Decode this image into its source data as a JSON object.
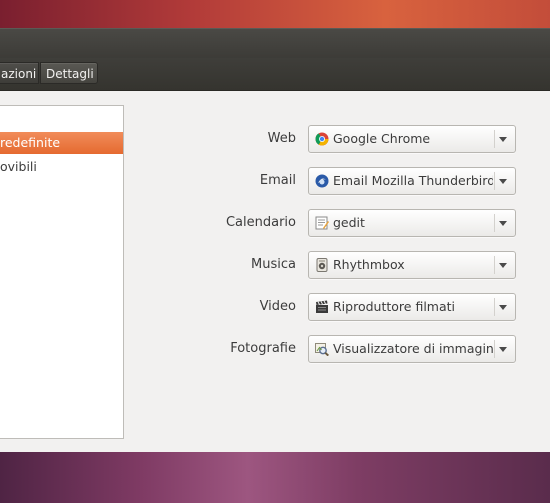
{
  "toolbar": {
    "breadcrumbs": [
      "azioni",
      "Dettagli"
    ]
  },
  "sidebar": {
    "items": [
      "redefinite",
      "ovibili"
    ]
  },
  "defaults": [
    {
      "label": "Web",
      "value": "Google Chrome",
      "icon": "chrome-icon"
    },
    {
      "label": "Email",
      "value": "Email Mozilla Thunderbird",
      "icon": "thunderbird-icon"
    },
    {
      "label": "Calendario",
      "value": "gedit",
      "icon": "gedit-icon"
    },
    {
      "label": "Musica",
      "value": "Rhythmbox",
      "icon": "rhythmbox-icon"
    },
    {
      "label": "Video",
      "value": "Riproduttore filmati",
      "icon": "movie-player-icon"
    },
    {
      "label": "Fotografie",
      "value": "Visualizzatore di immagini",
      "icon": "image-viewer-icon"
    }
  ],
  "colors": {
    "selection": "#e56a30",
    "window_bg": "#f2f1f0",
    "titlebar": "#3c3b37"
  }
}
